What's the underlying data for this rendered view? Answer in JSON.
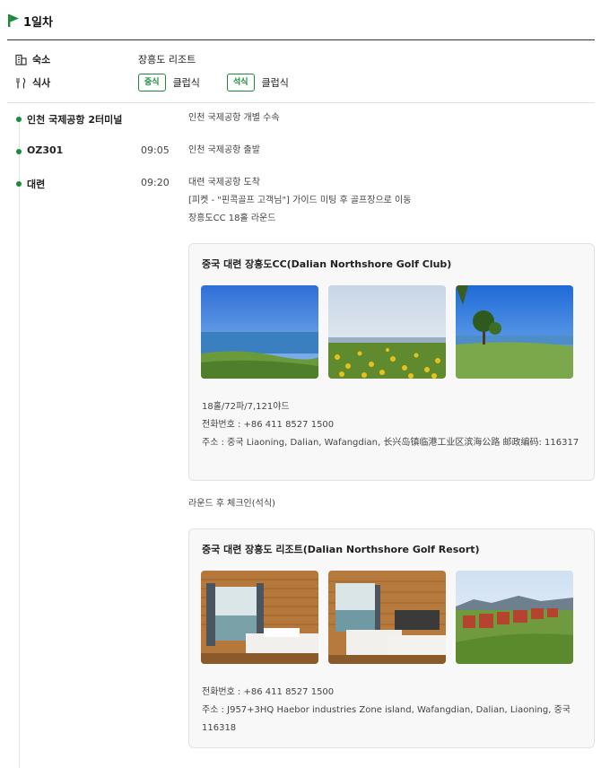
{
  "day": {
    "title": "1일차"
  },
  "info": {
    "lodging_label": "숙소",
    "lodging_value": "장흥도 리조트",
    "meal_label": "식사",
    "meals": [
      {
        "tag": "중식",
        "value": "클럽식"
      },
      {
        "tag": "석식",
        "value": "클럽식"
      }
    ]
  },
  "timeline": [
    {
      "place": "인천 국제공항 2터미널",
      "time": "",
      "lines": [
        "인천 국제공항 개별 수속"
      ]
    },
    {
      "place": "OZ301",
      "time": "09:05",
      "lines": [
        "인천 국제공항 출발"
      ]
    },
    {
      "place": "대련",
      "time": "09:20",
      "lines": [
        "대련 국제공항 도착",
        "[피켓 - \"핀콕골프 고객님\"] 가이드 미팅 후 골프장으로 이동",
        "장흥도CC 18홀 라운드"
      ]
    }
  ],
  "cards": [
    {
      "title": "중국 대련 장흥도CC(Dalian Northshore Golf Club)",
      "photos": [
        "golf-course-sea-photo",
        "golf-course-flowers-photo",
        "golf-course-tree-photo"
      ],
      "details": [
        "18홀/72파/7,121야드",
        "전화번호 : +86 411 8527 1500",
        "주소 : 중국 Liaoning, Dalian, Wafangdian, 长兴岛镇临港工业区滨海公路 邮政编码: 116317"
      ]
    },
    {
      "title": "중국 대련 장흥도 리조트(Dalian Northshore Golf Resort)",
      "photos": [
        "resort-room-photo-1",
        "resort-room-photo-2",
        "resort-exterior-photo"
      ],
      "details": [
        "전화번호 : +86 411 8527 1500",
        "주소 : J957+3HQ Haebor industries Zone island, Wafangdian, Dalian, Liaoning, 중국 116318"
      ]
    }
  ],
  "after_round_text": "라운드 후 체크인(석식)",
  "colors": {
    "accent": "#1a8a3c",
    "divider": "#e0e0e0",
    "card_bg": "#f8f8f8"
  }
}
